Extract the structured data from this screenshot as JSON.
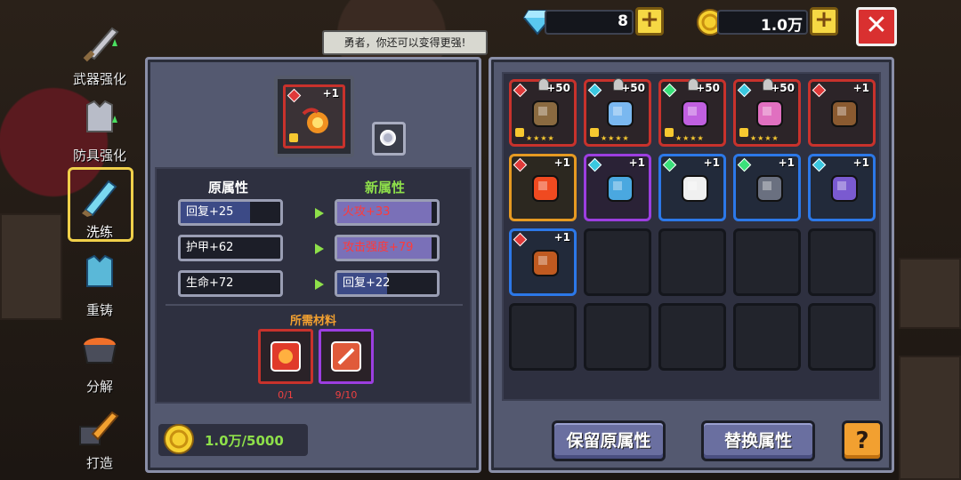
{
  "currency": {
    "gems_value": "8",
    "gold_value": "1.0万"
  },
  "tooltip": "勇者，你还可以变得更强!",
  "side_menu": [
    {
      "label": "武器强化",
      "icon": "sword-upgrade-icon"
    },
    {
      "label": "防具强化",
      "icon": "armor-upgrade-icon"
    },
    {
      "label": "洗练",
      "icon": "refine-icon",
      "active": true
    },
    {
      "label": "重铸",
      "icon": "recast-icon"
    },
    {
      "label": "分解",
      "icon": "disassemble-icon"
    },
    {
      "label": "打造",
      "icon": "forge-icon"
    }
  ],
  "refine": {
    "item_level": "+1",
    "old_title": "原属性",
    "new_title": "新属性",
    "old_stats": [
      {
        "text": "回复+25",
        "fill": 0.7
      },
      {
        "text": "护甲+62",
        "fill": 0
      },
      {
        "text": "生命+72",
        "fill": 0
      }
    ],
    "new_stats": [
      {
        "text": "火攻+33",
        "fill": 0.95
      },
      {
        "text": "攻击强度+79",
        "fill": 0.95
      },
      {
        "text": "回复+22",
        "fill": 0.5
      }
    ],
    "materials_title": "所需材料",
    "materials": [
      {
        "count": "0/1",
        "color": "#c8322c"
      },
      {
        "count": "9/10",
        "color": "#9c3ee0"
      }
    ],
    "gold_cost": "1.0万/5000"
  },
  "inventory": [
    {
      "rarity": "red",
      "gem": "r",
      "level": "+50",
      "locked": true,
      "stars": "★★★★",
      "icon": "spiked-mace-icon"
    },
    {
      "rarity": "red",
      "gem": "c",
      "level": "+50",
      "locked": true,
      "stars": "★★★★",
      "icon": "blade-sword-icon"
    },
    {
      "rarity": "red",
      "gem": "g",
      "level": "+50",
      "locked": true,
      "stars": "★★★★",
      "icon": "scythe-icon"
    },
    {
      "rarity": "red",
      "gem": "c",
      "level": "+50",
      "locked": true,
      "stars": "★★★★",
      "icon": "crystal-staff-icon"
    },
    {
      "rarity": "red",
      "gem": "r",
      "level": "+1",
      "locked": false,
      "stars": "",
      "icon": "armor-check-icon"
    },
    {
      "rarity": "orange",
      "gem": "r",
      "level": "+1",
      "locked": false,
      "stars": "",
      "icon": "fire-orb-icon"
    },
    {
      "rarity": "purple",
      "gem": "c",
      "level": "+1",
      "locked": false,
      "stars": "",
      "icon": "sniper-rifle-icon"
    },
    {
      "rarity": "blue",
      "gem": "g",
      "level": "+1",
      "locked": false,
      "stars": "",
      "icon": "slime-icon"
    },
    {
      "rarity": "blue",
      "gem": "g",
      "level": "+1",
      "locked": false,
      "stars": "",
      "icon": "whip-icon"
    },
    {
      "rarity": "blue",
      "gem": "c",
      "level": "+1",
      "locked": false,
      "stars": "",
      "icon": "fish-icon"
    },
    {
      "rarity": "blue",
      "gem": "r",
      "level": "+1",
      "locked": false,
      "stars": "",
      "icon": "shotgun-icon"
    }
  ],
  "buttons": {
    "keep": "保留原属性",
    "swap": "替换属性",
    "help": "?",
    "close": "✕",
    "plus": "+"
  }
}
